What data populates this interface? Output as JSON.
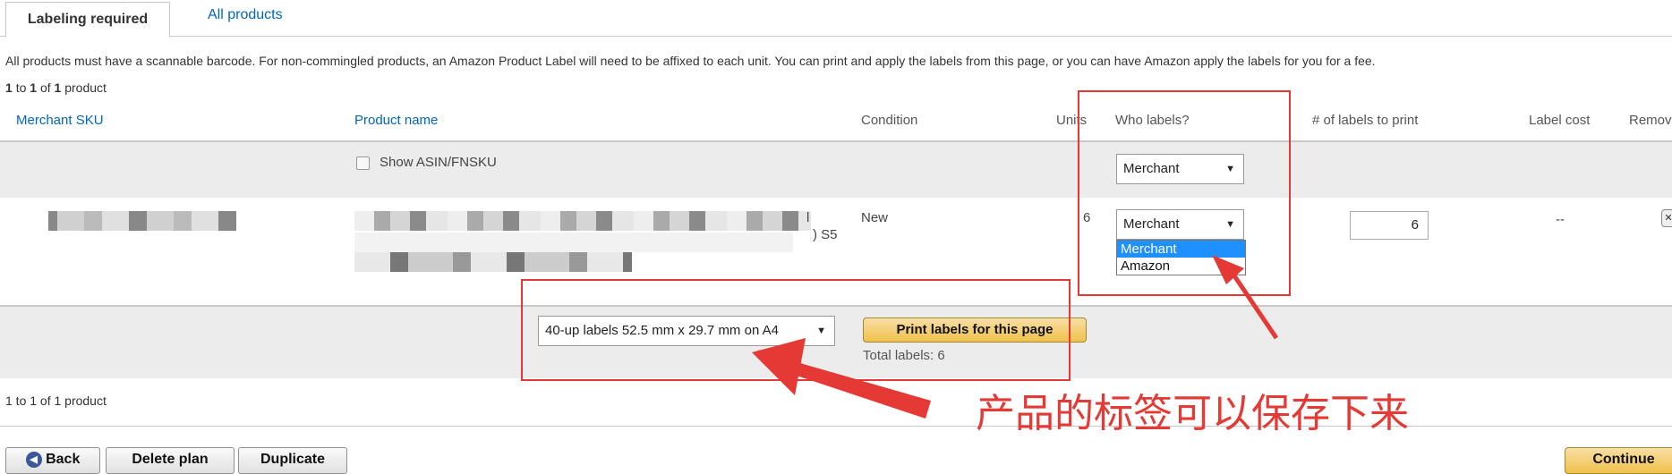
{
  "tabs": [
    {
      "label": "Labeling required",
      "active": true
    },
    {
      "label": "All products",
      "active": false
    }
  ],
  "description": "All products must have a scannable barcode. For non-commingled products, an Amazon Product Label will need to be affixed to each unit. You can print and apply the labels from this page, or you can have Amazon apply the labels for you for a fee.",
  "pagination_top": {
    "from": "1",
    "to_word": "to",
    "to": "1",
    "of_word": "of",
    "total": "1",
    "unit": "product"
  },
  "columns": {
    "sku": "Merchant SKU",
    "name": "Product name",
    "condition": "Condition",
    "units": "Units",
    "who": "Who labels?",
    "labels": "# of labels to print",
    "cost": "Label cost",
    "remove": "Remov"
  },
  "show_asin": "Show ASIN/FNSKU",
  "bulk_who": "Merchant",
  "item": {
    "name_suffix": ") S5",
    "name_char": "l",
    "condition": "New",
    "units": "6",
    "who": "Merchant",
    "labels_to_print": "6",
    "label_cost": "--"
  },
  "who_options": [
    "Merchant",
    "Amazon"
  ],
  "who_highlighted": "Merchant",
  "label_format": "40-up labels 52.5 mm x 29.7 mm on A4",
  "print_button": "Print labels for this page",
  "total_labels": "Total labels: 6",
  "pagination_bottom": "1 to 1 of 1 product",
  "buttons": {
    "back": "Back",
    "delete": "Delete plan",
    "duplicate": "Duplicate",
    "continue": "Continue"
  },
  "annotation": "产品的标签可以保存下来",
  "colors": {
    "annotation": "#e53935",
    "link": "#0066c0",
    "highlight": "#1e90ff"
  }
}
